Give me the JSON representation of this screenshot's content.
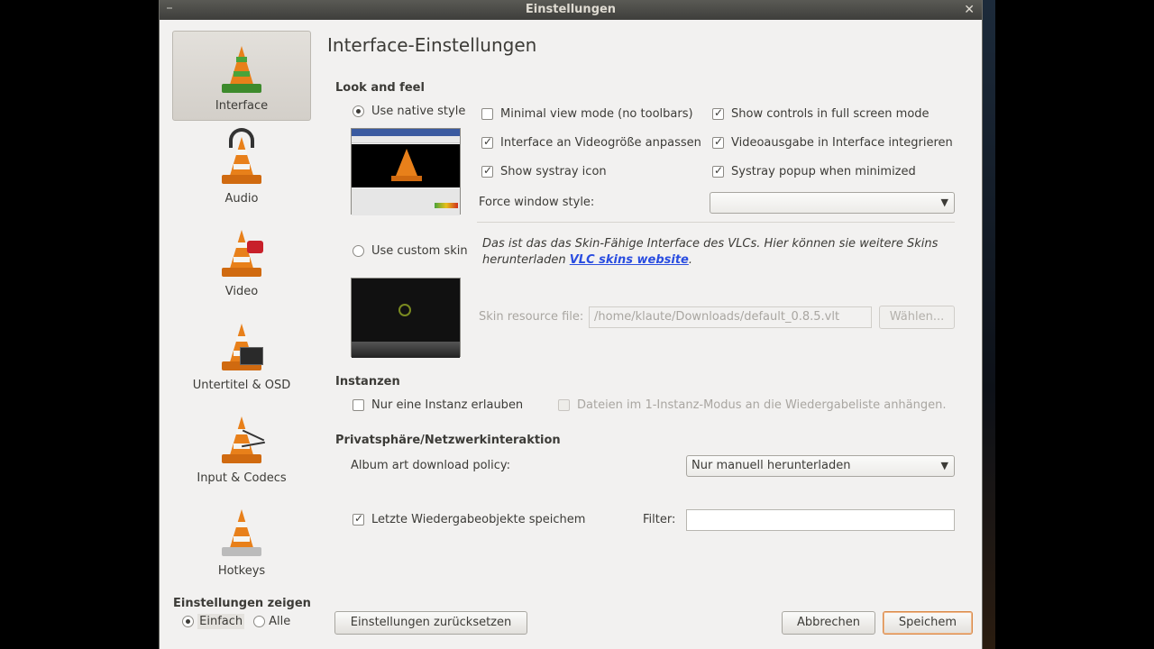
{
  "window": {
    "title": "Einstellungen"
  },
  "sidebar": {
    "items": [
      {
        "label": "Interface"
      },
      {
        "label": "Audio"
      },
      {
        "label": "Video"
      },
      {
        "label": "Untertitel & OSD"
      },
      {
        "label": "Input & Codecs"
      },
      {
        "label": "Hotkeys"
      }
    ],
    "show_settings": {
      "label": "Einstellungen zeigen",
      "simple": "Einfach",
      "all": "Alle"
    }
  },
  "main": {
    "title": "Interface-Einstellungen",
    "look_and_feel": {
      "heading": "Look and feel",
      "native_style": "Use native style",
      "minimal_view": "Minimal view mode (no toolbars)",
      "show_controls_fullscreen": "Show controls in full screen mode",
      "interface_resize": "Interface an Videogröße anpassen",
      "video_integrated": "Videoausgabe in Interface integrieren",
      "systray_icon": "Show systray icon",
      "systray_popup": "Systray popup when minimized",
      "force_window_style_label": "Force window style:",
      "force_window_style_value": "",
      "custom_skin": "Use custom skin",
      "skin_desc": "Das ist das das Skin-Fähige Interface des VLCs. Hier können sie weitere Skins herunterladen",
      "skin_link": "VLC skins website",
      "skin_desc_end": ".",
      "skin_file_label": "Skin resource file:",
      "skin_file_value": "/home/klaute/Downloads/default_0.8.5.vlt",
      "choose_button": "Wählen..."
    },
    "instances": {
      "heading": "Instanzen",
      "one_instance": "Nur eine Instanz erlauben",
      "enqueue": "Dateien im 1-Instanz-Modus an die Wiedergabeliste anhängen."
    },
    "privacy": {
      "heading": "Privatsphäre/Netzwerkinteraktion",
      "album_art_label": "Album art download policy:",
      "album_art_value": "Nur manuell herunterladen",
      "save_recent": "Letzte Wiedergabeobjekte speichem",
      "filter_label": "Filter:",
      "filter_value": ""
    }
  },
  "footer": {
    "reset": "Einstellungen zurücksetzen",
    "cancel": "Abbrechen",
    "save": "Speichem"
  }
}
